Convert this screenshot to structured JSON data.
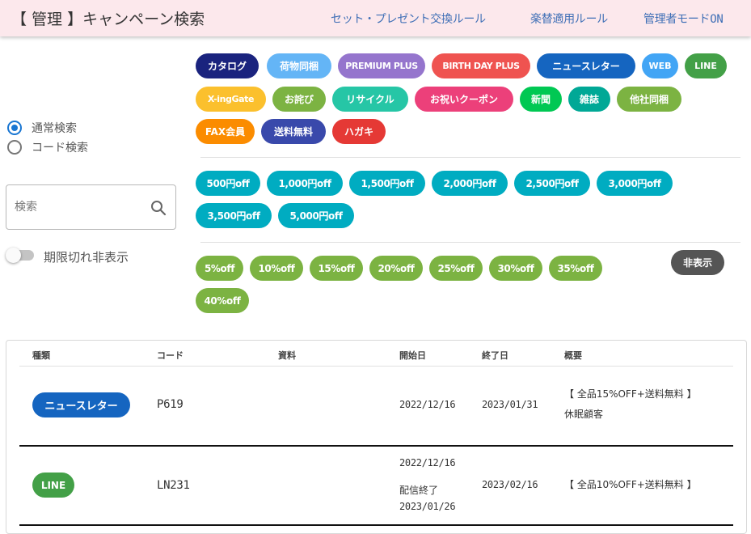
{
  "header": {
    "title": "【 管理 】キャンペーン検索",
    "links": [
      "セット・プレゼント交換ルール",
      "楽替適用ルール",
      "管理者モードON"
    ]
  },
  "search_mode": {
    "options": [
      "通常検索",
      "コード検索"
    ],
    "selected": "通常検索"
  },
  "search": {
    "placeholder": "検索",
    "value": ""
  },
  "expired_toggle": {
    "label": "期限切れ非表示",
    "on": false
  },
  "category_chips": [
    {
      "label": "カタログ",
      "color": "#1a237e"
    },
    {
      "label": "荷物同梱",
      "color": "#64b5f6"
    },
    {
      "label": "PREMIUM PLUS",
      "color": "#9575cd"
    },
    {
      "label": "BIRTH DAY PLUS",
      "color": "#ef5350"
    },
    {
      "label": "ニュースレター",
      "color": "#1565c0"
    },
    {
      "label": "WEB",
      "color": "#42a5f5"
    },
    {
      "label": "LINE",
      "color": "#43a047"
    },
    {
      "label": "X-ingGate",
      "color": "#fbc02d"
    },
    {
      "label": "お詫び",
      "color": "#7cb342"
    },
    {
      "label": "リサイクル",
      "color": "#26c6a6"
    },
    {
      "label": "お祝いクーポン",
      "color": "#ec407a"
    },
    {
      "label": "新聞",
      "color": "#00c853"
    },
    {
      "label": "雑誌",
      "color": "#00a896"
    },
    {
      "label": "他社同梱",
      "color": "#7cb342"
    },
    {
      "label": "FAX会員",
      "color": "#fb8c00"
    },
    {
      "label": "送料無料",
      "color": "#3949ab"
    },
    {
      "label": "ハガキ",
      "color": "#e53935"
    }
  ],
  "yen_chips": {
    "color": "#00acc1",
    "labels": [
      "500円off",
      "1,000円off",
      "1,500円off",
      "2,000円off",
      "2,500円off",
      "3,000円off",
      "3,500円off",
      "5,000円off"
    ]
  },
  "percent_chips": {
    "color": "#7cb342",
    "labels": [
      "5%off",
      "10%off",
      "15%off",
      "20%off",
      "25%off",
      "30%off",
      "35%off",
      "40%off"
    ]
  },
  "hide_button": {
    "label": "非表示",
    "color": "#555555"
  },
  "table": {
    "headers": [
      "種類",
      "コード",
      "資料",
      "開始日",
      "終了日",
      "概要"
    ],
    "rows": [
      {
        "type": "ニュースレター",
        "type_color": "#1565c0",
        "code": "P619",
        "material": "",
        "start": "2022/12/16",
        "start_note": "",
        "start_note_date": "",
        "end": "2023/01/31",
        "summary_line1": "【 全品15%OFF+送料無料 】",
        "summary_line2": "休眠顧客"
      },
      {
        "type": "LINE",
        "type_color": "#43a047",
        "code": "LN231",
        "material": "",
        "start": "2022/12/16",
        "start_note": "配信終了",
        "start_note_date": "2023/01/26",
        "end": "2023/02/16",
        "summary_line1": "【 全品10%OFF+送料無料 】",
        "summary_line2": ""
      }
    ]
  }
}
